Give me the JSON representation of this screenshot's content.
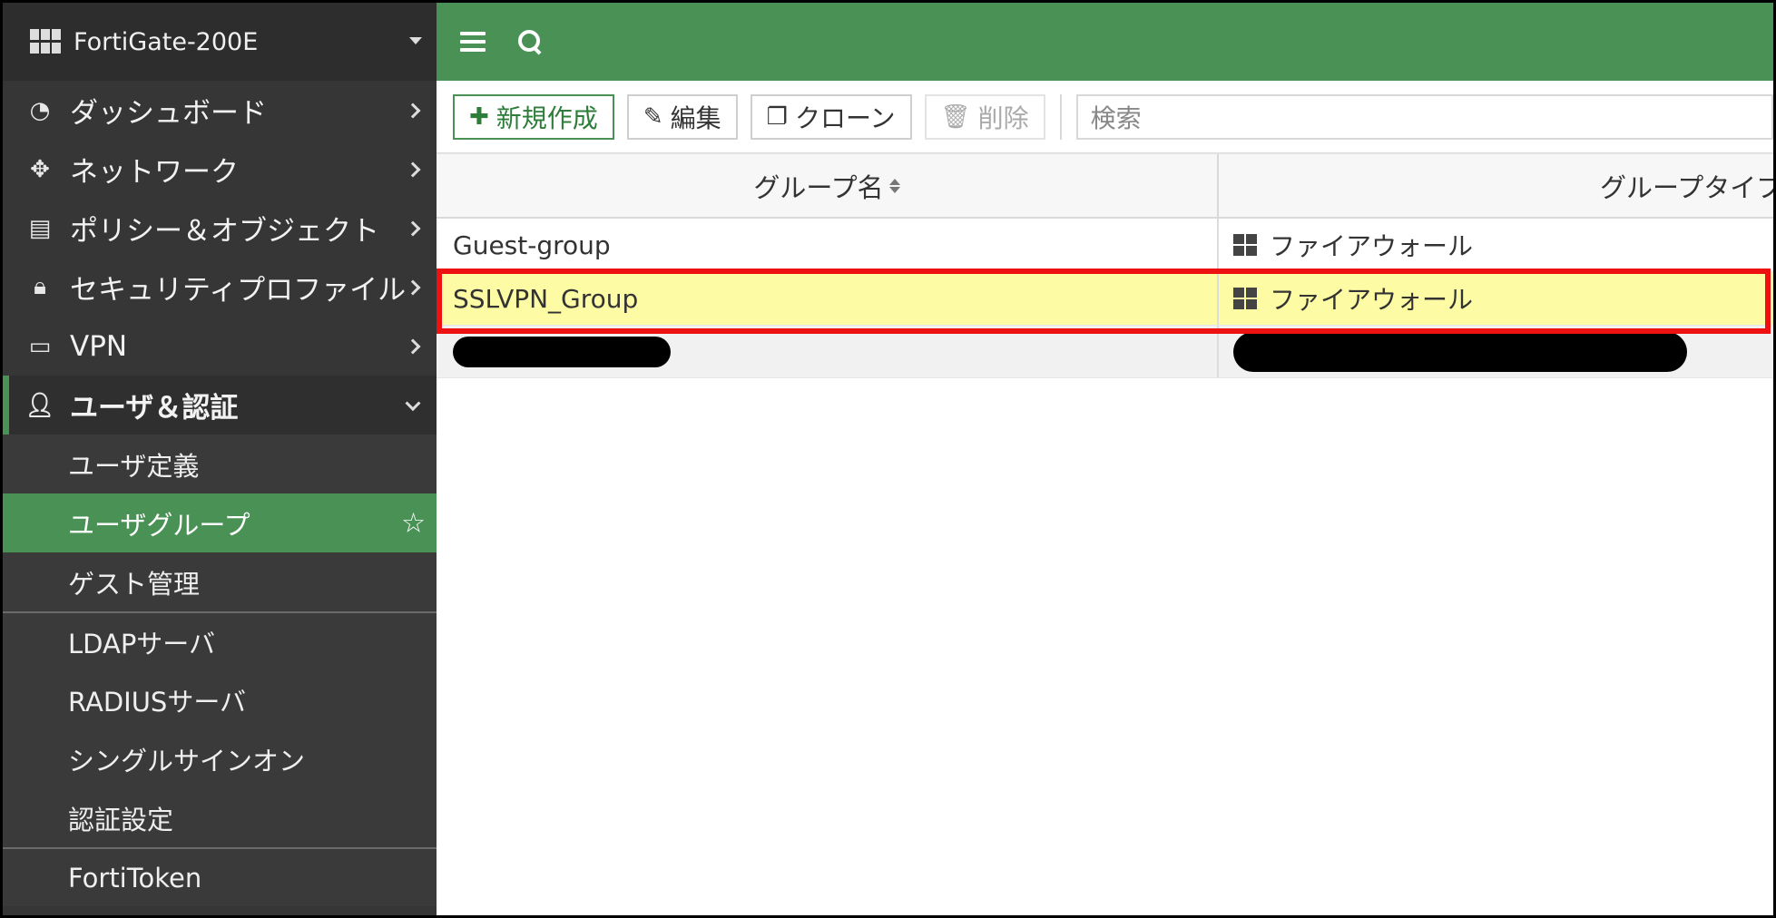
{
  "device": {
    "name": "FortiGate-200E"
  },
  "sidebar": {
    "items": [
      {
        "label": "ダッシュボード",
        "icon": "gauge-icon"
      },
      {
        "label": "ネットワーク",
        "icon": "move-arrows-icon"
      },
      {
        "label": "ポリシー＆オブジェクト",
        "icon": "policy-doc-icon"
      },
      {
        "label": "セキュリティプロファイル",
        "icon": "lock-icon"
      },
      {
        "label": "VPN",
        "icon": "laptop-icon"
      },
      {
        "label": "ユーザ＆認証",
        "icon": "user-icon"
      }
    ],
    "subitems": [
      {
        "label": "ユーザ定義"
      },
      {
        "label": "ユーザグループ"
      },
      {
        "label": "ゲスト管理"
      },
      {
        "label": "LDAPサーバ"
      },
      {
        "label": "RADIUSサーバ"
      },
      {
        "label": "シングルサインオン"
      },
      {
        "label": "認証設定"
      },
      {
        "label": "FortiToken"
      }
    ]
  },
  "toolbar": {
    "create_label": "新規作成",
    "edit_label": "編集",
    "clone_label": "クローン",
    "delete_label": "削除",
    "search_placeholder": "検索"
  },
  "table": {
    "columns": [
      "グループ名",
      "グループタイプ"
    ],
    "rows": [
      {
        "name": "Guest-group",
        "type": "ファイアウォール"
      },
      {
        "name": "SSLVPN_Group",
        "type": "ファイアウォール"
      }
    ]
  },
  "colors": {
    "accent": "#4a9155",
    "highlight_border": "#ee1111",
    "selected_row": "#fdfca5",
    "sidebar_bg": "#363636"
  }
}
